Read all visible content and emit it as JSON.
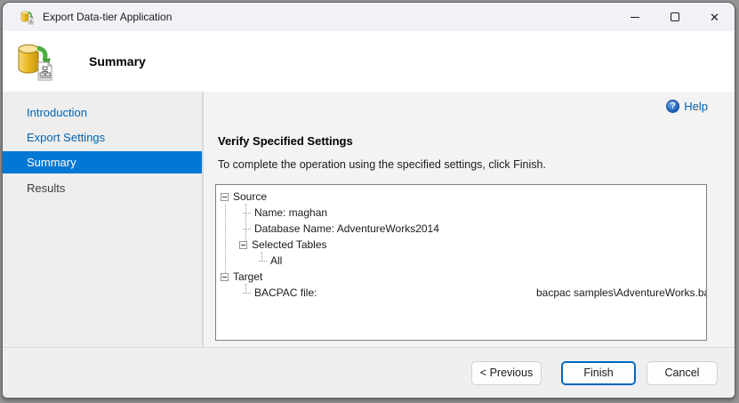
{
  "window": {
    "title": "Export Data-tier Application"
  },
  "icons": {
    "close": "✕",
    "help": "?"
  },
  "header": {
    "title": "Summary"
  },
  "sidebar": {
    "items": [
      {
        "label": "Introduction",
        "state": "link"
      },
      {
        "label": "Export Settings",
        "state": "link"
      },
      {
        "label": "Summary",
        "state": "selected"
      },
      {
        "label": "Results",
        "state": "plain"
      }
    ]
  },
  "content": {
    "help_label": "Help",
    "heading": "Verify Specified Settings",
    "instruction": "To complete the operation using the specified settings, click Finish.",
    "tree": {
      "rows": [
        {
          "label": "Source",
          "depth": 0,
          "expander": true
        },
        {
          "label": "Name: maghan",
          "depth": 1
        },
        {
          "label": "Database Name: AdventureWorks2014",
          "depth": 1
        },
        {
          "label": "Selected Tables",
          "depth": 1,
          "expander": true
        },
        {
          "label": "All",
          "depth": 2
        },
        {
          "label": "Target",
          "depth": 0,
          "expander": true
        },
        {
          "label": "BACPAC file:",
          "depth": 1,
          "value": "bacpac samples\\AdventureWorks.ba"
        }
      ]
    }
  },
  "footer": {
    "previous_label": "< Previous",
    "finish_label": "Finish",
    "cancel_label": "Cancel"
  },
  "colors": {
    "accent": "#0078d4",
    "link": "#0063b1",
    "finish_border": "#0067c0"
  }
}
